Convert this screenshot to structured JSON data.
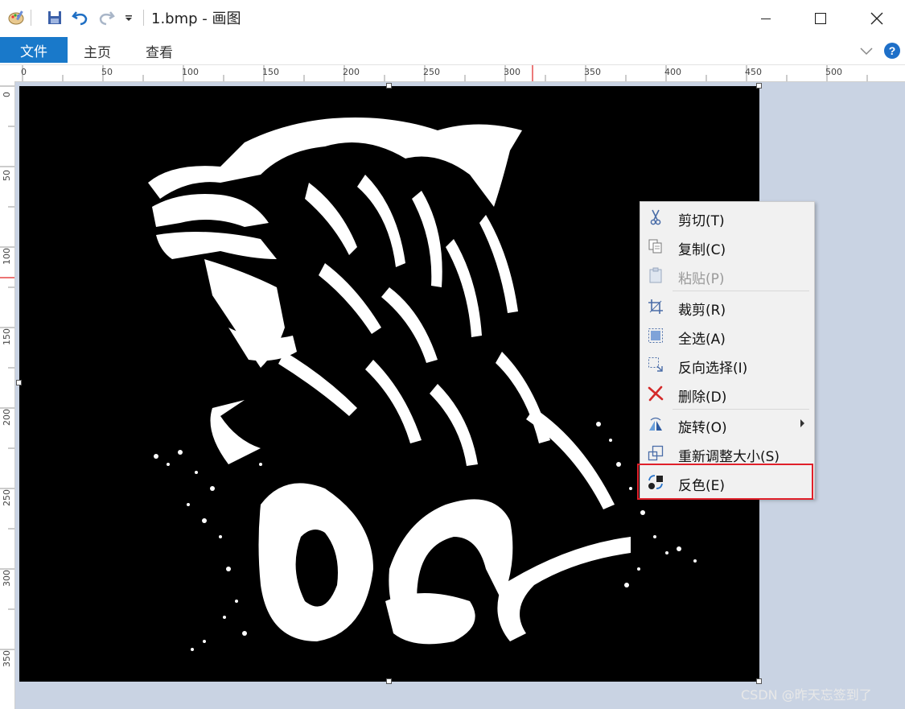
{
  "window": {
    "title": "1.bmp - 画图",
    "controls": [
      "minimize",
      "maximize",
      "close"
    ]
  },
  "quick_access": {
    "icons": [
      "paint-app-icon",
      "save-icon",
      "undo-icon",
      "redo-icon",
      "customize-dropdown-icon"
    ]
  },
  "ribbon": {
    "tabs": [
      {
        "label": "文件",
        "active": true
      },
      {
        "label": "主页",
        "active": false
      },
      {
        "label": "查看",
        "active": false
      }
    ]
  },
  "rulers": {
    "top_labels": [
      "0",
      "50",
      "100",
      "150",
      "200",
      "250",
      "300",
      "350",
      "400",
      "450",
      "500"
    ],
    "left_labels": [
      "0",
      "50",
      "100",
      "150",
      "200",
      "250",
      "300",
      "350"
    ]
  },
  "context_menu": {
    "items": [
      {
        "label": "剪切(T)",
        "icon": "scissors-icon",
        "enabled": true
      },
      {
        "label": "复制(C)",
        "icon": "copy-icon",
        "enabled": true
      },
      {
        "label": "粘贴(P)",
        "icon": "paste-icon",
        "enabled": false
      },
      {
        "label": "裁剪(R)",
        "icon": "crop-icon",
        "enabled": true
      },
      {
        "label": "全选(A)",
        "icon": "select-all-icon",
        "enabled": true
      },
      {
        "label": "反向选择(I)",
        "icon": "invert-selection-icon",
        "enabled": true
      },
      {
        "label": "删除(D)",
        "icon": "delete-icon",
        "enabled": true
      },
      {
        "label": "旋转(O)",
        "icon": "rotate-icon",
        "enabled": true,
        "submenu": true
      },
      {
        "label": "重新调整大小(S)",
        "icon": "resize-icon",
        "enabled": true
      },
      {
        "label": "反色(E)",
        "icon": "invert-color-icon",
        "enabled": true,
        "highlighted": true
      }
    ]
  },
  "watermark": "CSDN @昨天忘签到了",
  "colors": {
    "file_tab": "#1979ca",
    "workspace": "#c9d3e3",
    "highlight_border": "#e0202a"
  }
}
